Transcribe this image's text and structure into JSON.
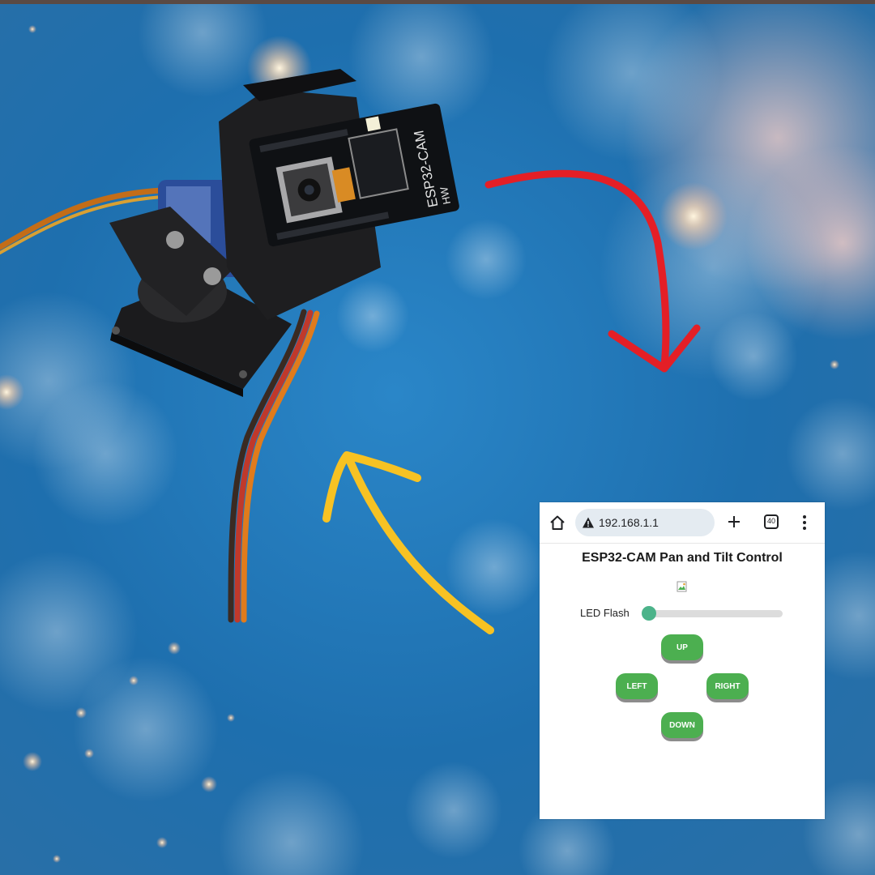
{
  "browser": {
    "url": "192.168.1.1",
    "tab_count": "40"
  },
  "page": {
    "title": "ESP32-CAM Pan and Tilt Control",
    "flash_label": "LED Flash",
    "flash_value": 0,
    "buttons": {
      "up": "UP",
      "left": "LEFT",
      "right": "RIGHT",
      "down": "DOWN"
    }
  },
  "board": {
    "model": "ESP32-CAM",
    "marking": "HW"
  },
  "colors": {
    "button": "#4caf50",
    "slider_thumb": "#4cb38a",
    "red_arrow": "#e41f26",
    "yellow_arrow": "#f7c223",
    "background": "#1d6aa8"
  }
}
